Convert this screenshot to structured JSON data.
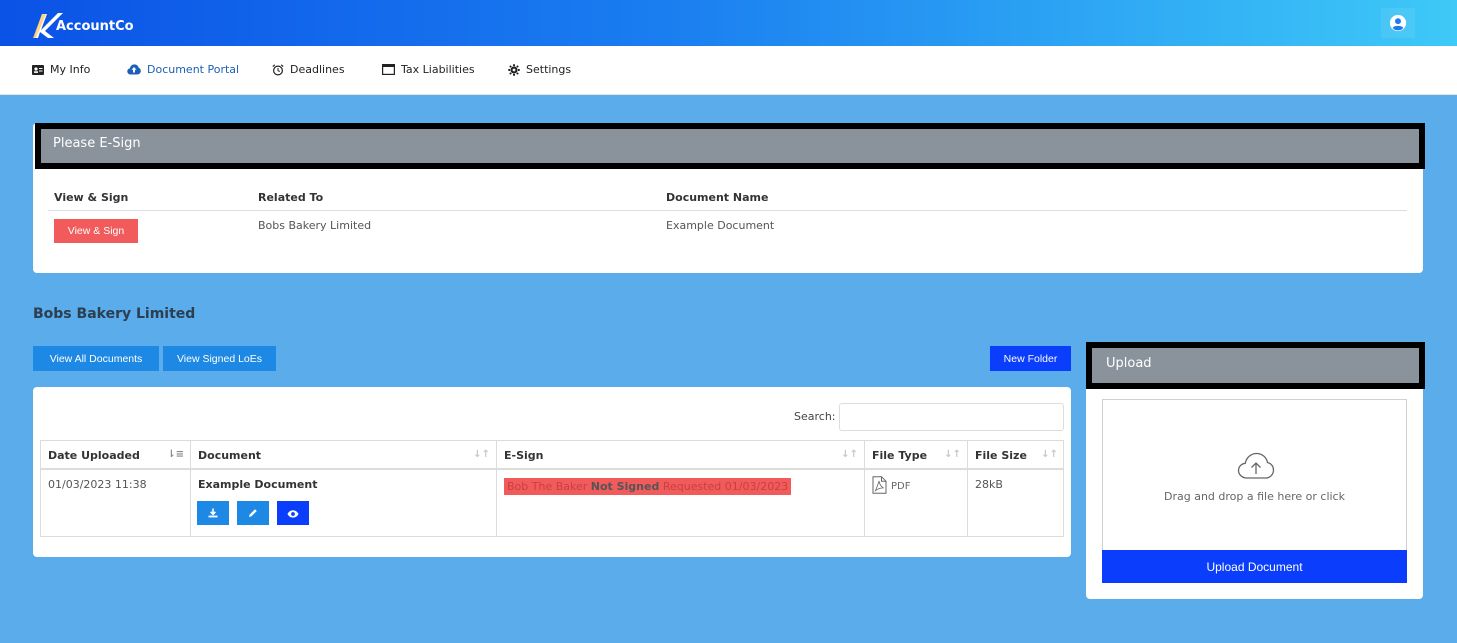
{
  "app": {
    "brand": "AccountCo"
  },
  "nav": {
    "items": [
      {
        "label": "My Info",
        "icon": "id-card-icon"
      },
      {
        "label": "Document Portal",
        "icon": "cloud-upload-icon",
        "active": true
      },
      {
        "label": "Deadlines",
        "icon": "alarm-clock-icon"
      },
      {
        "label": "Tax Liabilities",
        "icon": "window-icon"
      },
      {
        "label": "Settings",
        "icon": "gear-icon"
      }
    ]
  },
  "esign": {
    "title": "Please E-Sign",
    "columns": [
      "View & Sign",
      "Related To",
      "Document Name"
    ],
    "rows": [
      {
        "button": "View & Sign",
        "related_to": "Bobs Bakery Limited",
        "document_name": "Example Document"
      }
    ]
  },
  "documents": {
    "company": "Bobs Bakery Limited",
    "buttons": {
      "view_all": "View All Documents",
      "view_signed": "View Signed LoEs",
      "new_folder": "New Folder"
    },
    "search_label": "Search:",
    "search_value": "",
    "columns": [
      "Date Uploaded",
      "Document",
      "E-Sign",
      "File Type",
      "File Size"
    ],
    "rows": [
      {
        "date_uploaded": "01/03/2023 11:38",
        "document": "Example Document",
        "esign_name": "Bob The Baker",
        "esign_status": "Not Signed",
        "esign_requested": "Requested 01/03/2023",
        "file_type": "PDF",
        "file_size": "28kB"
      }
    ]
  },
  "upload": {
    "title": "Upload",
    "drop_text": "Drag and drop a file here or click",
    "button": "Upload Document"
  },
  "colors": {
    "page_bg": "#5aacea",
    "header_gradient_start": "#0b52e6",
    "header_gradient_end": "#3ec9f7",
    "primary": "#1e88e5",
    "primary_dark": "#0a3dfc",
    "danger": "#f25b5b",
    "panel_header": "#8a939b"
  }
}
